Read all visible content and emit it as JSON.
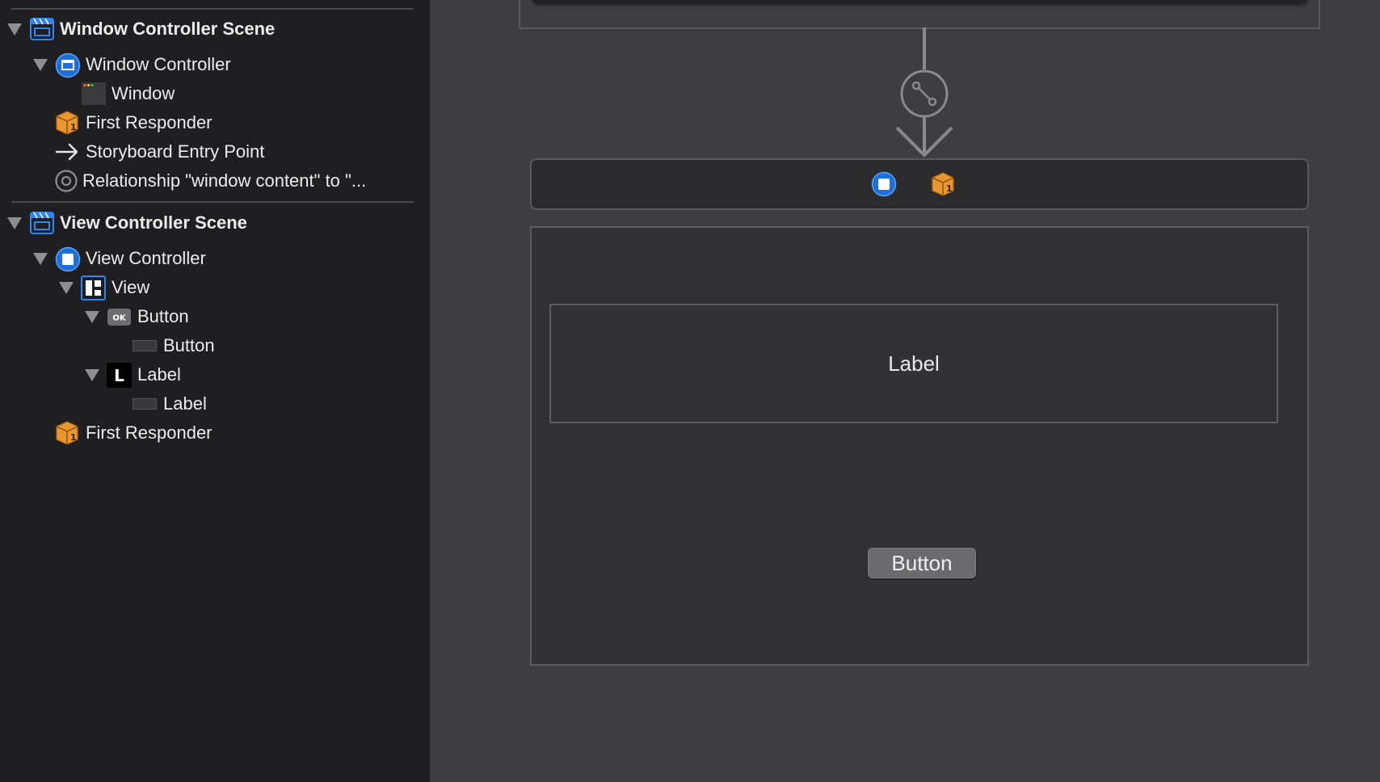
{
  "outline": {
    "window_scene": {
      "title": "Window Controller Scene",
      "window_controller": "Window Controller",
      "window": "Window",
      "first_responder": "First Responder",
      "entry_point": "Storyboard Entry Point",
      "relationship": "Relationship \"window content\" to \"..."
    },
    "view_scene": {
      "title": "View Controller Scene",
      "view_controller": "View Controller",
      "view": "View",
      "button": "Button",
      "button_cell": "Button",
      "label": "Label",
      "label_cell": "Label",
      "first_responder": "First Responder"
    }
  },
  "canvas": {
    "label_text": "Label",
    "button_text": "Button"
  },
  "icons": {
    "scene": "storyboard-scene-icon",
    "window_controller": "window-controller-icon",
    "window": "window-icon",
    "first_responder": "first-responder-cube-icon",
    "entry_point": "arrow-right-icon",
    "relationship": "relationship-circle-icon",
    "view_controller": "view-controller-icon",
    "view": "view-layout-icon",
    "button": "ok-button-icon",
    "label": "label-l-icon",
    "cell": "cell-bar-icon",
    "segue": "segue-relationship-icon"
  },
  "colors": {
    "accent_blue": "#1e6fd9",
    "responder_orange": "#e8962e",
    "sidebar_bg": "#1f1f21",
    "canvas_bg": "#3e3e40"
  }
}
